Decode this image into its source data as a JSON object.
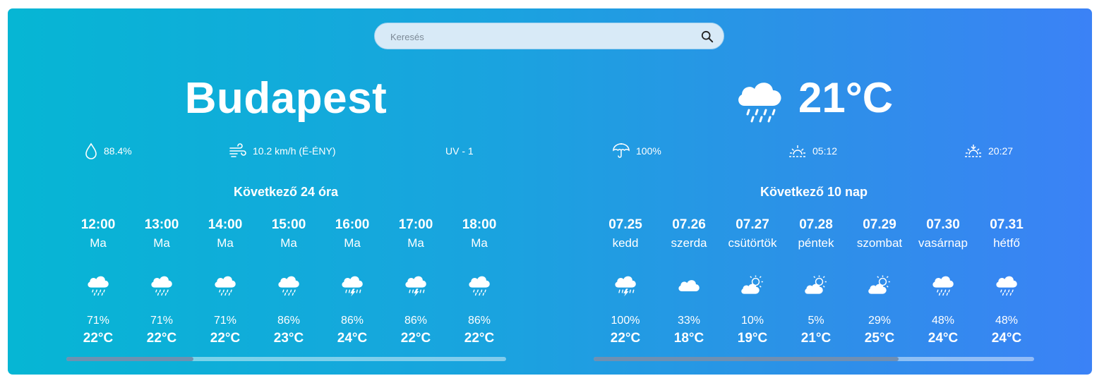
{
  "search": {
    "placeholder": "Keresés",
    "value": ""
  },
  "city": "Budapest",
  "current": {
    "temp": "21°C",
    "icon": "rain-cloud-icon"
  },
  "stats": {
    "humidity": "88.4%",
    "wind": "10.2 km/h (É-ÉNY)",
    "uv": "UV - 1",
    "precip": "100%",
    "sunrise": "05:12",
    "sunset": "20:27"
  },
  "hourly": {
    "title": "Következő 24 óra",
    "scroll_position": 0.0,
    "items": [
      {
        "time": "12:00",
        "day": "Ma",
        "icon": "rain",
        "precip": "71%",
        "temp": "22°C"
      },
      {
        "time": "13:00",
        "day": "Ma",
        "icon": "rain",
        "precip": "71%",
        "temp": "22°C"
      },
      {
        "time": "14:00",
        "day": "Ma",
        "icon": "rain",
        "precip": "71%",
        "temp": "22°C"
      },
      {
        "time": "15:00",
        "day": "Ma",
        "icon": "rain",
        "precip": "86%",
        "temp": "23°C"
      },
      {
        "time": "16:00",
        "day": "Ma",
        "icon": "thunder",
        "precip": "86%",
        "temp": "24°C"
      },
      {
        "time": "17:00",
        "day": "Ma",
        "icon": "thunder",
        "precip": "86%",
        "temp": "22°C"
      },
      {
        "time": "18:00",
        "day": "Ma",
        "icon": "rain",
        "precip": "86%",
        "temp": "22°C"
      }
    ]
  },
  "daily": {
    "title": "Következő 10 nap",
    "scroll_position": 0.0,
    "items": [
      {
        "date": "07.25",
        "day": "kedd",
        "icon": "thunder",
        "precip": "100%",
        "temp": "22°C"
      },
      {
        "date": "07.26",
        "day": "szerda",
        "icon": "cloud",
        "precip": "33%",
        "temp": "18°C"
      },
      {
        "date": "07.27",
        "day": "csütörtök",
        "icon": "partly-sunny",
        "precip": "10%",
        "temp": "19°C"
      },
      {
        "date": "07.28",
        "day": "péntek",
        "icon": "partly-sunny",
        "precip": "5%",
        "temp": "21°C"
      },
      {
        "date": "07.29",
        "day": "szombat",
        "icon": "partly-sunny",
        "precip": "29%",
        "temp": "25°C"
      },
      {
        "date": "07.30",
        "day": "vasárnap",
        "icon": "rain",
        "precip": "48%",
        "temp": "24°C"
      },
      {
        "date": "07.31",
        "day": "hétfő",
        "icon": "rain",
        "precip": "48%",
        "temp": "24°C"
      }
    ]
  }
}
